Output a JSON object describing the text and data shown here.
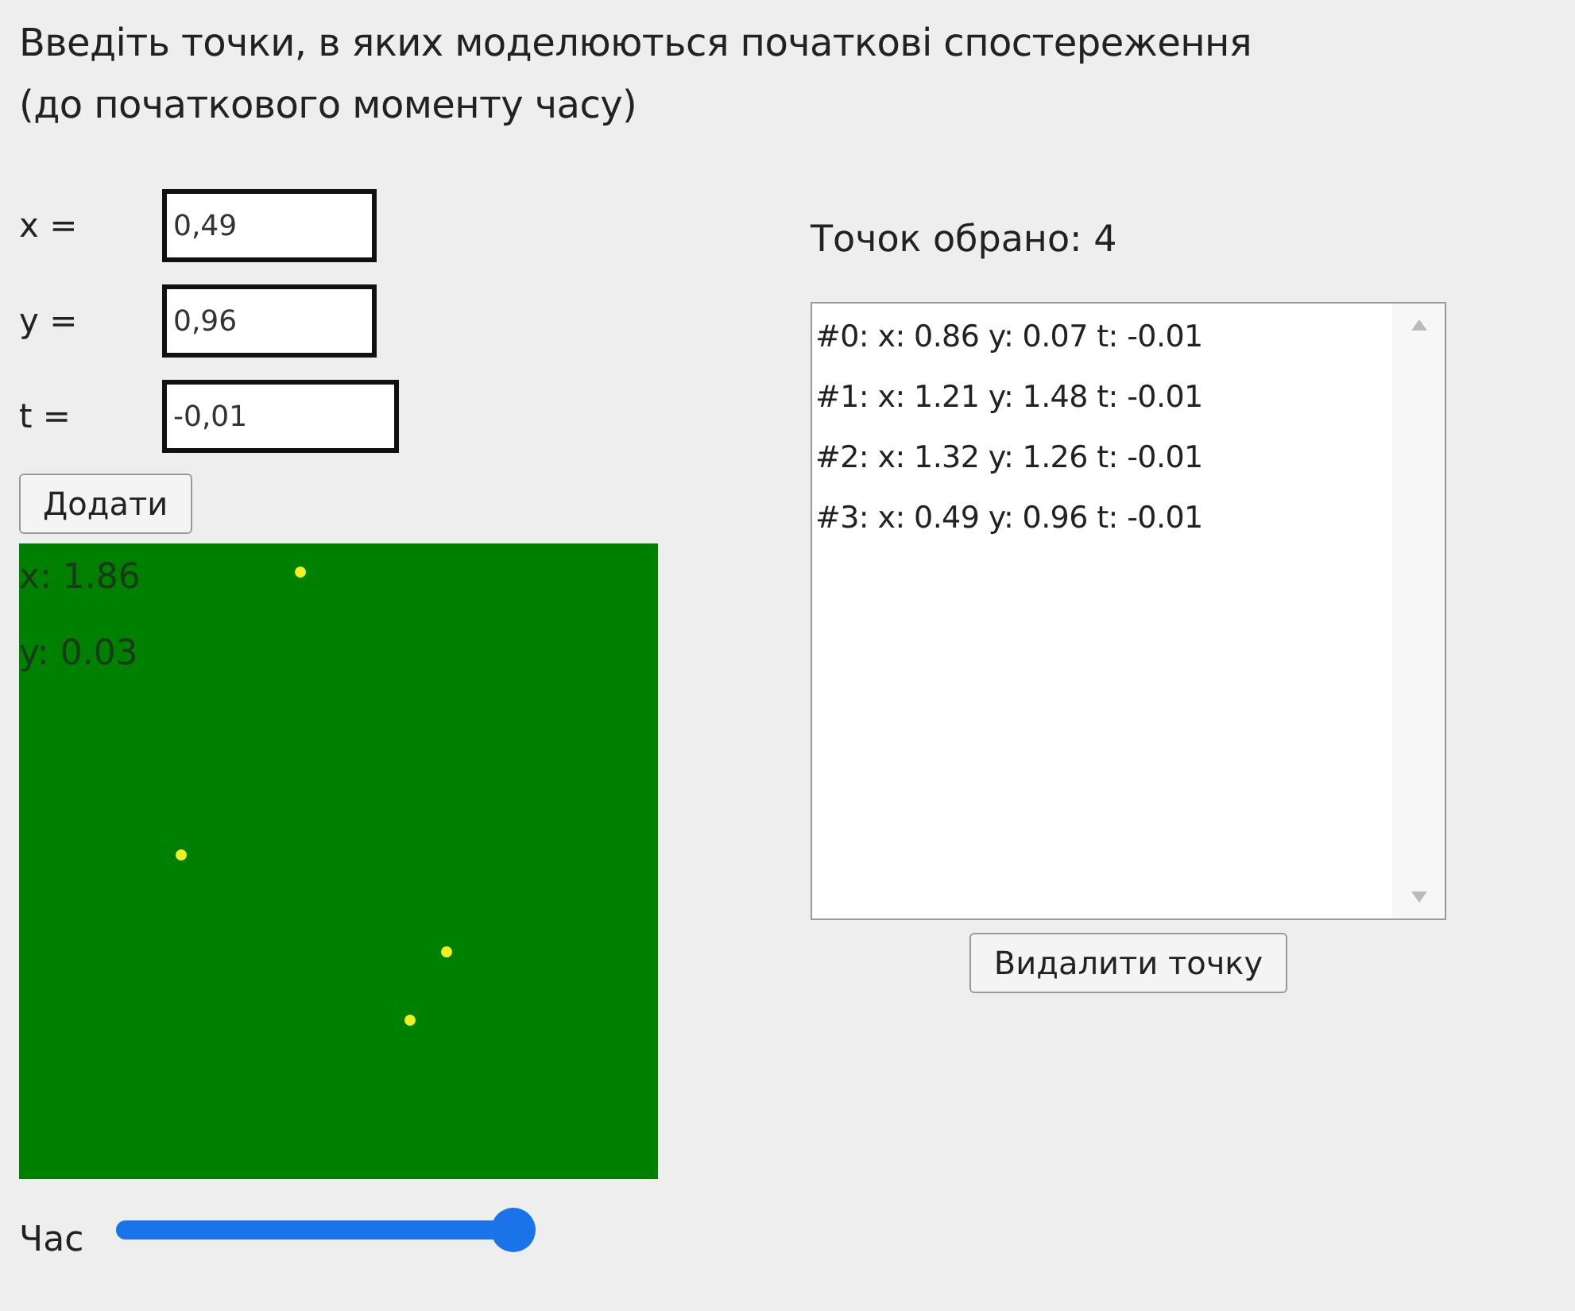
{
  "heading_lines": [
    "Введіть точки, в яких моделюються початкові спостереження",
    "(до початкового моменту часу)"
  ],
  "fields": [
    {
      "label": "x =",
      "value": "0,49"
    },
    {
      "label": "y =",
      "value": "0,96"
    },
    {
      "label": "t =",
      "value": "-0,01"
    }
  ],
  "add_button": "Додати",
  "canvas": {
    "cursor_lines": [
      "x: 1.86",
      "y: 0.03"
    ]
  },
  "time_slider": {
    "label": "Час",
    "level": 1
  },
  "count_label": "Точок обрано: 4",
  "points": [
    {
      "text": "#0: x: 0.86 y: 0.07 t: -0.01",
      "selected": false
    },
    {
      "text": "#1: x: 1.21 y: 1.48 t: -0.01",
      "selected": false
    },
    {
      "text": "#2: x: 1.32 y: 1.26 t: -0.01",
      "selected": false
    },
    {
      "text": "#3: x: 0.49 y: 0.96 t: -0.01",
      "selected": false
    }
  ],
  "delete_button": "Видалити точку"
}
